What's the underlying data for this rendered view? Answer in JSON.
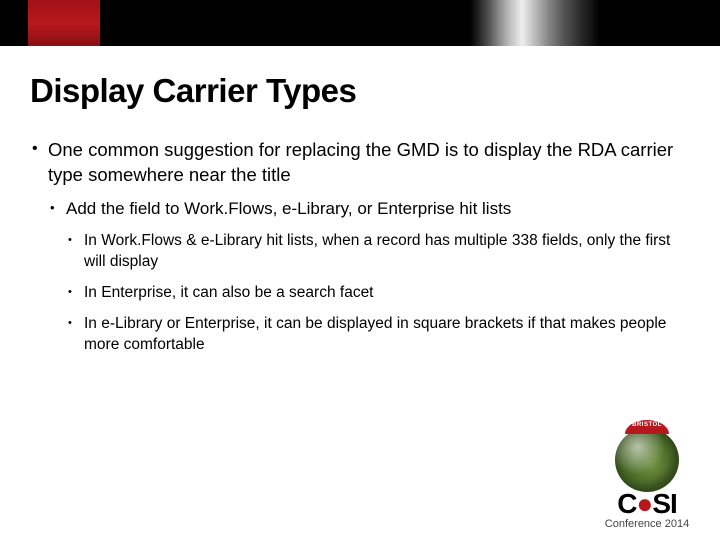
{
  "title": "Display Carrier Types",
  "bullets": {
    "l1": "One common suggestion for replacing the GMD is to display the RDA carrier type somewhere near the title",
    "l2": "Add the field to Work.Flows, e-Library, or Enterprise hit lists",
    "l3a": "In Work.Flows & e-Library hit lists, when a record has multiple 338 fields, only the first will display",
    "l3b": "In Enterprise, it can also be a search facet",
    "l3c": "In e-Library or Enterprise, it can be displayed in square brackets if that makes people more comfortable"
  },
  "logo": {
    "banner": "BRISTOL",
    "pre": "C",
    "post": "SI",
    "sub": "Conference 2014"
  }
}
